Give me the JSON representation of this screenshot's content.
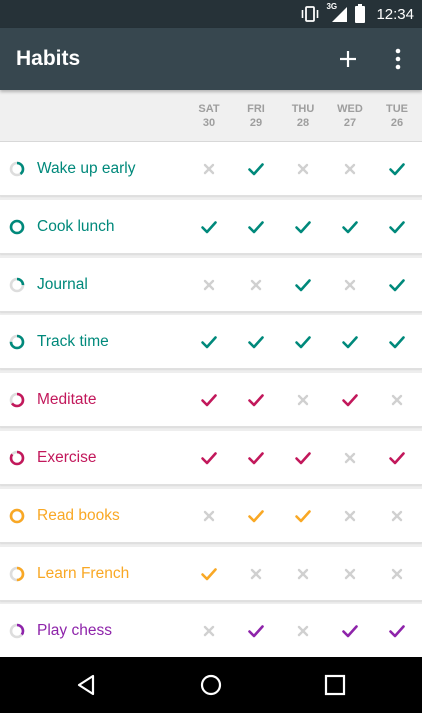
{
  "status_bar": {
    "time": "12:34",
    "network": "3G",
    "icons": [
      "vibrate-icon",
      "signal-icon",
      "battery-icon"
    ]
  },
  "app_bar": {
    "title": "Habits",
    "actions": [
      "add-icon",
      "more-vert-icon"
    ]
  },
  "days": [
    {
      "weekday": "SAT",
      "date": "30"
    },
    {
      "weekday": "FRI",
      "date": "29"
    },
    {
      "weekday": "THU",
      "date": "28"
    },
    {
      "weekday": "WED",
      "date": "27"
    },
    {
      "weekday": "TUE",
      "date": "26"
    }
  ],
  "habits": [
    {
      "name": "Wake up early",
      "color": "#00897b",
      "score": 0.4,
      "checks": [
        false,
        true,
        false,
        false,
        true
      ]
    },
    {
      "name": "Cook lunch",
      "color": "#00897b",
      "score": 1.0,
      "checks": [
        true,
        true,
        true,
        true,
        true
      ]
    },
    {
      "name": "Journal",
      "color": "#00897b",
      "score": 0.25,
      "checks": [
        false,
        false,
        true,
        false,
        true
      ]
    },
    {
      "name": "Track time",
      "color": "#00897b",
      "score": 0.75,
      "checks": [
        true,
        true,
        true,
        true,
        true
      ]
    },
    {
      "name": "Meditate",
      "color": "#c2185b",
      "score": 0.65,
      "checks": [
        true,
        true,
        false,
        true,
        false
      ]
    },
    {
      "name": "Exercise",
      "color": "#c2185b",
      "score": 0.85,
      "checks": [
        true,
        true,
        true,
        false,
        true
      ]
    },
    {
      "name": "Read books",
      "color": "#f9a825",
      "score": 1.0,
      "checks": [
        false,
        true,
        true,
        false,
        false
      ]
    },
    {
      "name": "Learn French",
      "color": "#f9a825",
      "score": 0.5,
      "checks": [
        true,
        false,
        false,
        false,
        false
      ]
    },
    {
      "name": "Play chess",
      "color": "#8e24aa",
      "score": 0.35,
      "checks": [
        false,
        true,
        false,
        true,
        true
      ]
    }
  ],
  "colors": {
    "status_bar": "#263238",
    "app_bar": "#37474f",
    "unchecked": "#d0d0d0",
    "header_text": "#9e9e9e",
    "nav_bar": "#000000"
  },
  "nav_bar": [
    "back-icon",
    "home-icon",
    "recents-icon"
  ]
}
